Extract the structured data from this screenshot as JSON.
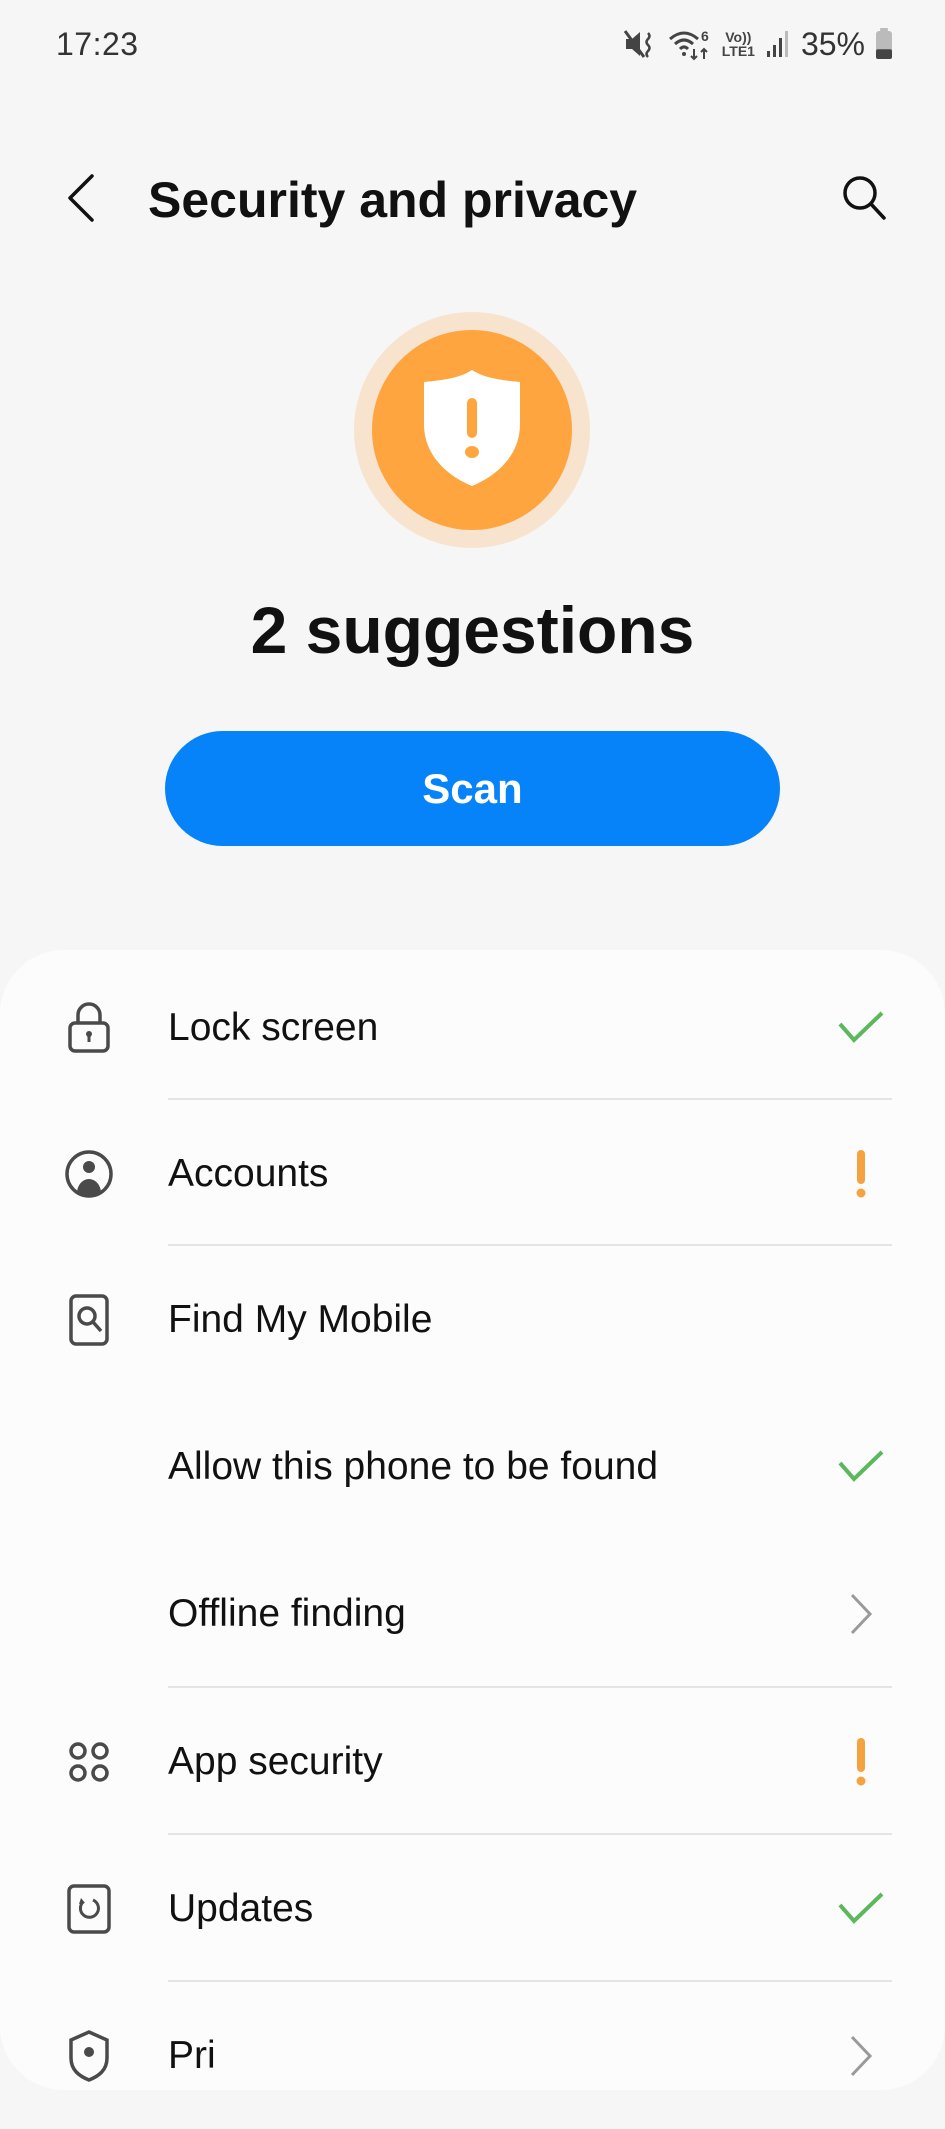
{
  "status_bar": {
    "time": "17:23",
    "icons": [
      "mute-vibrate-icon",
      "wifi-6-icon",
      "volte-lte1-icon",
      "signal-icon",
      "battery-icon"
    ],
    "volte_top": "Vo))",
    "volte_bottom": "LTE1",
    "wifi_badge": "6",
    "battery_percent": "35%",
    "battery_level": 0.35
  },
  "app_bar": {
    "back_icon": "chevron-left-icon",
    "title": "Security and privacy",
    "search_icon": "search-icon"
  },
  "hero": {
    "icon": "shield-warning-icon",
    "summary": "2 suggestions",
    "scan_label": "Scan"
  },
  "colors": {
    "accent_blue": "#0683f9",
    "warning_orange": "#ffa53f",
    "ok_green": "#5cb85c",
    "chevron_gray": "#9a9a9a"
  },
  "list": {
    "items": [
      {
        "label": "Lock screen",
        "icon": "lock-icon",
        "status": "ok"
      },
      {
        "label": "Accounts",
        "icon": "account-circle-icon",
        "status": "warning"
      },
      {
        "label": "Find My Mobile",
        "icon": "find-my-mobile-icon",
        "status": "none"
      },
      {
        "label": "Allow this phone to be found",
        "icon": "",
        "status": "ok"
      },
      {
        "label": "Offline finding",
        "icon": "",
        "status": "chevron"
      },
      {
        "label": "App security",
        "icon": "app-grid-icon",
        "status": "warning"
      },
      {
        "label": "Updates",
        "icon": "update-icon",
        "status": "ok"
      },
      {
        "label": "Pri",
        "icon": "privacy-shield-icon",
        "status": "chevron"
      }
    ]
  }
}
